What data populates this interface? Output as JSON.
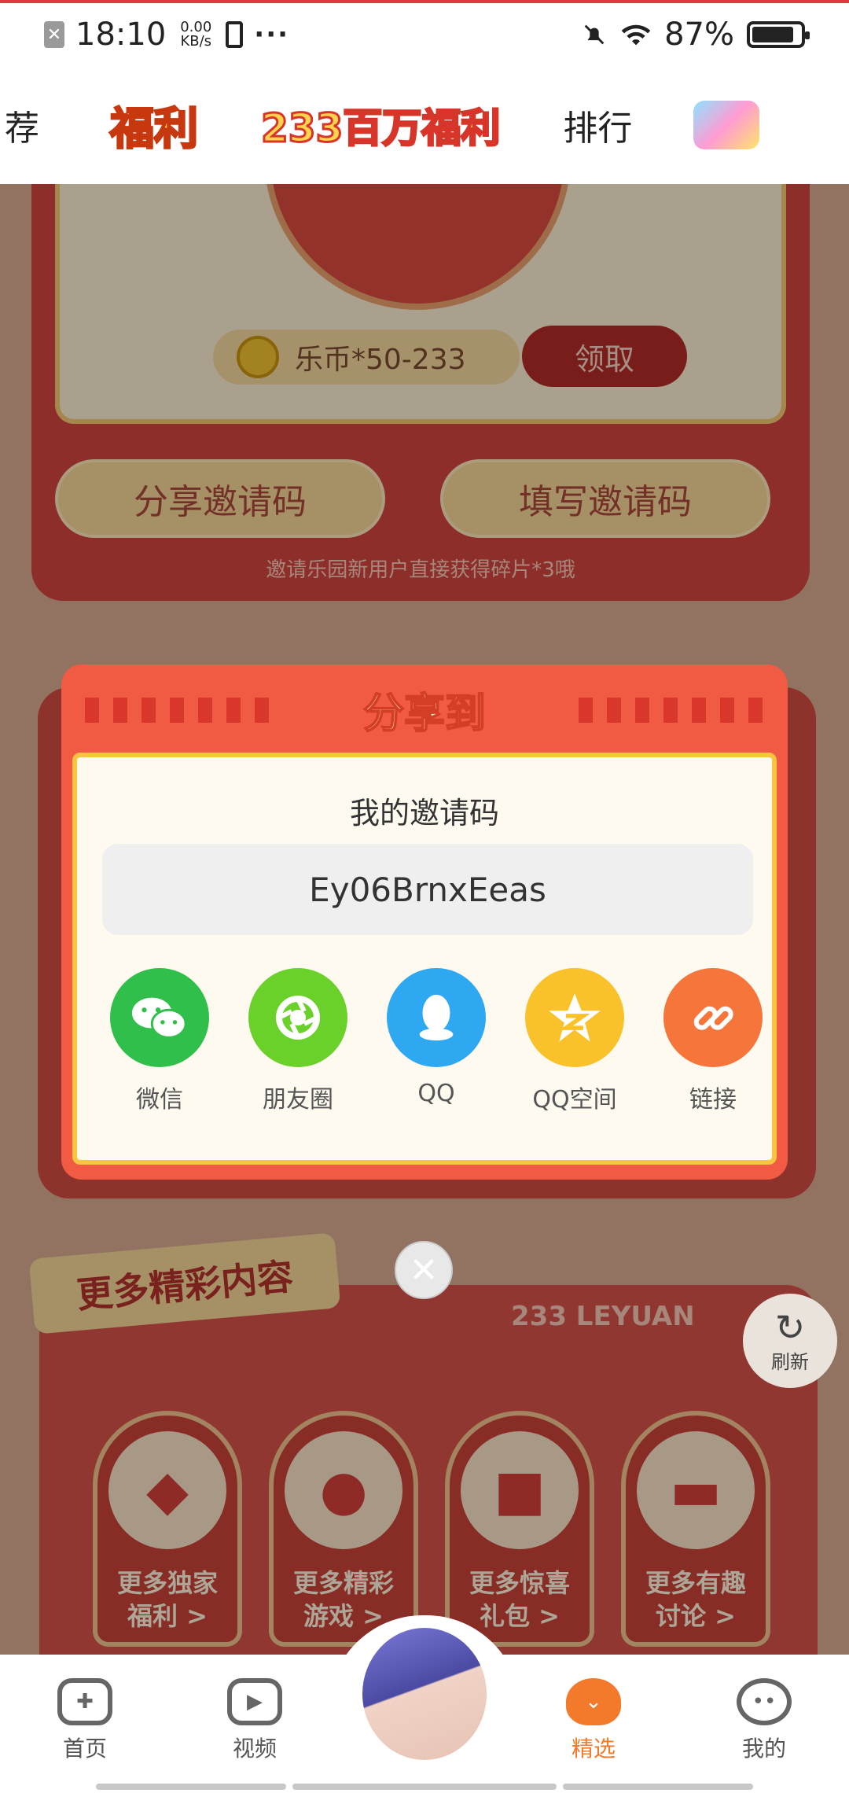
{
  "status_bar": {
    "time": "18:10",
    "speed_value": "0.00",
    "speed_unit": "KB/s",
    "battery": "87%",
    "battery_level": 0.87
  },
  "top_nav": {
    "items": [
      "荐",
      "福利",
      "233百万福利",
      "排行"
    ]
  },
  "card1": {
    "coin_text": "乐币*50-233",
    "claim_label": "领取",
    "share_code_btn": "分享邀请码",
    "fill_code_btn": "填写邀请码",
    "tip": "邀请乐园新用户直接获得碎片*3哦"
  },
  "more": {
    "title": "更多精彩内容",
    "leyuan": "233 LEYUAN",
    "items": [
      {
        "line1": "更多独家",
        "line2": "福利 >",
        "icon": "diamond-icon"
      },
      {
        "line1": "更多精彩",
        "line2": "游戏 >",
        "icon": "fire-icon"
      },
      {
        "line1": "更多惊喜",
        "line2": "礼包 >",
        "icon": "gift-icon"
      },
      {
        "line1": "更多有趣",
        "line2": "讨论 >",
        "icon": "chat-icon"
      }
    ]
  },
  "refresh_label": "刷新",
  "modal": {
    "title": "分享到",
    "subtitle": "我的邀请码",
    "code": "Ey06BrnxEeas",
    "share_targets": [
      {
        "label": "微信",
        "icon": "wechat-icon",
        "color": "#2fbf4a"
      },
      {
        "label": "朋友圈",
        "icon": "moments-icon",
        "color": "#6ad12a"
      },
      {
        "label": "QQ",
        "icon": "qq-icon",
        "color": "#2fa8f2"
      },
      {
        "label": "QQ空间",
        "icon": "qzone-icon",
        "color": "#f9c12a"
      },
      {
        "label": "链接",
        "icon": "link-icon",
        "color": "#f5753a"
      }
    ]
  },
  "bottom_nav": {
    "items": [
      {
        "label": "首页",
        "icon": "gamepad-icon"
      },
      {
        "label": "视频",
        "icon": "video-icon"
      },
      {
        "label": "精选",
        "icon": "featured-icon",
        "active": true
      },
      {
        "label": "我的",
        "icon": "profile-icon"
      }
    ]
  }
}
